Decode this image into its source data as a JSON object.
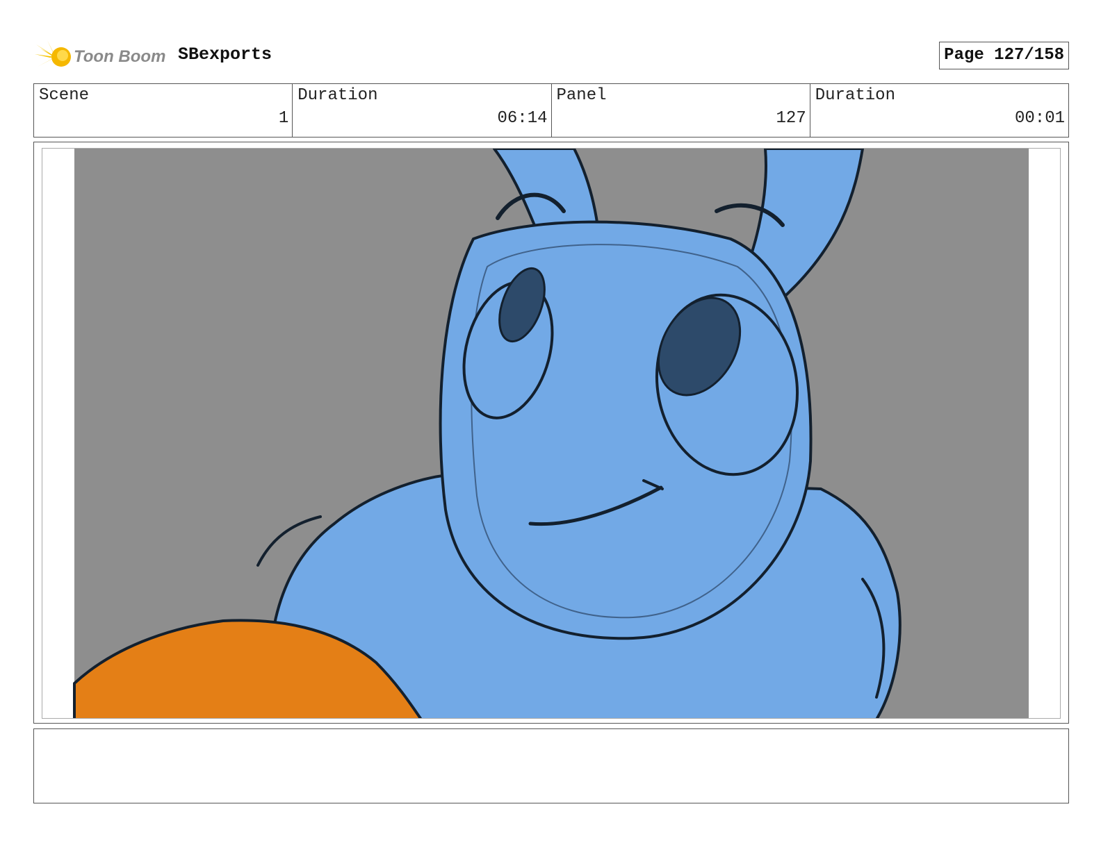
{
  "header": {
    "logo_text": "Toon Boom",
    "logo_icon": "toon-boom-burst-icon",
    "project_title": "SBexports",
    "page_label": "Page 127/158"
  },
  "info": {
    "scene_label": "Scene",
    "scene_value": "1",
    "scene_duration_label": "Duration",
    "scene_duration_value": "06:14",
    "panel_label": "Panel",
    "panel_value": "127",
    "panel_duration_label": "Duration",
    "panel_duration_value": "00:01"
  },
  "panel_image": {
    "description_icon": "storyboard-drawing",
    "colors": {
      "background": "#8e8e8e",
      "character": "#72a9e6",
      "prop": "#e47f16",
      "linework": "#13202e"
    }
  },
  "notes": {
    "text": ""
  }
}
